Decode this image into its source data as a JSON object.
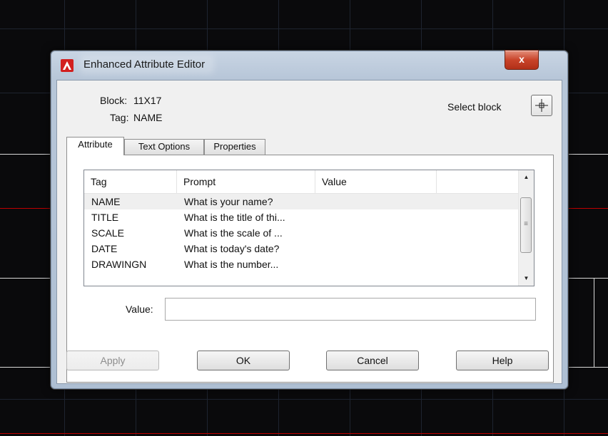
{
  "window": {
    "title": "Enhanced Attribute Editor",
    "close_label": "x"
  },
  "block_info": {
    "block_label": "Block:",
    "block_value": "11X17",
    "tag_label": "Tag:",
    "tag_value": "NAME",
    "select_block_label": "Select block"
  },
  "tabs": [
    {
      "label": "Attribute",
      "active": true
    },
    {
      "label": "Text Options",
      "active": false
    },
    {
      "label": "Properties",
      "active": false
    }
  ],
  "attribute_list": {
    "columns": [
      "Tag",
      "Prompt",
      "Value"
    ],
    "rows": [
      {
        "tag": "NAME",
        "prompt": "What is your name?",
        "value": "",
        "selected": true
      },
      {
        "tag": "TITLE",
        "prompt": "What is the title of thi...",
        "value": "",
        "selected": false
      },
      {
        "tag": "SCALE",
        "prompt": "What is the scale of ...",
        "value": "",
        "selected": false
      },
      {
        "tag": "DATE",
        "prompt": "What is today's date?",
        "value": "",
        "selected": false
      },
      {
        "tag": "DRAWINGN",
        "prompt": "What is the number...",
        "value": "",
        "selected": false
      }
    ]
  },
  "value_field": {
    "label": "Value:",
    "value": ""
  },
  "buttons": {
    "apply": "Apply",
    "ok": "OK",
    "cancel": "Cancel",
    "help": "Help"
  },
  "colors": {
    "accent_red": "#c00000",
    "icon_red": "#d21f1f"
  }
}
